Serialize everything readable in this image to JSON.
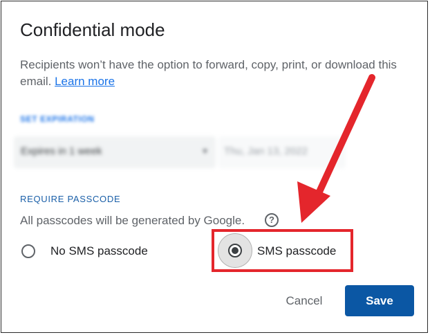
{
  "dialog": {
    "title": "Confidential mode",
    "description": "Recipients won’t have the option to forward, copy, print, or download this email.",
    "learn_more": "Learn more"
  },
  "expiration": {
    "label": "SET EXPIRATION",
    "selected": "Expires in 1 week",
    "date": "Thu, Jan 13, 2022"
  },
  "passcode": {
    "label": "REQUIRE PASSCODE",
    "info": "All passcodes will be generated by Google.",
    "options": [
      {
        "label": "No SMS passcode",
        "selected": false
      },
      {
        "label": "SMS passcode",
        "selected": true
      }
    ]
  },
  "actions": {
    "cancel": "Cancel",
    "save": "Save"
  },
  "colors": {
    "annotation": "#e4262c",
    "link": "#1a73e8",
    "primary_button": "#0b57a4"
  },
  "icons": [
    "help-icon",
    "chevron-down-icon"
  ]
}
